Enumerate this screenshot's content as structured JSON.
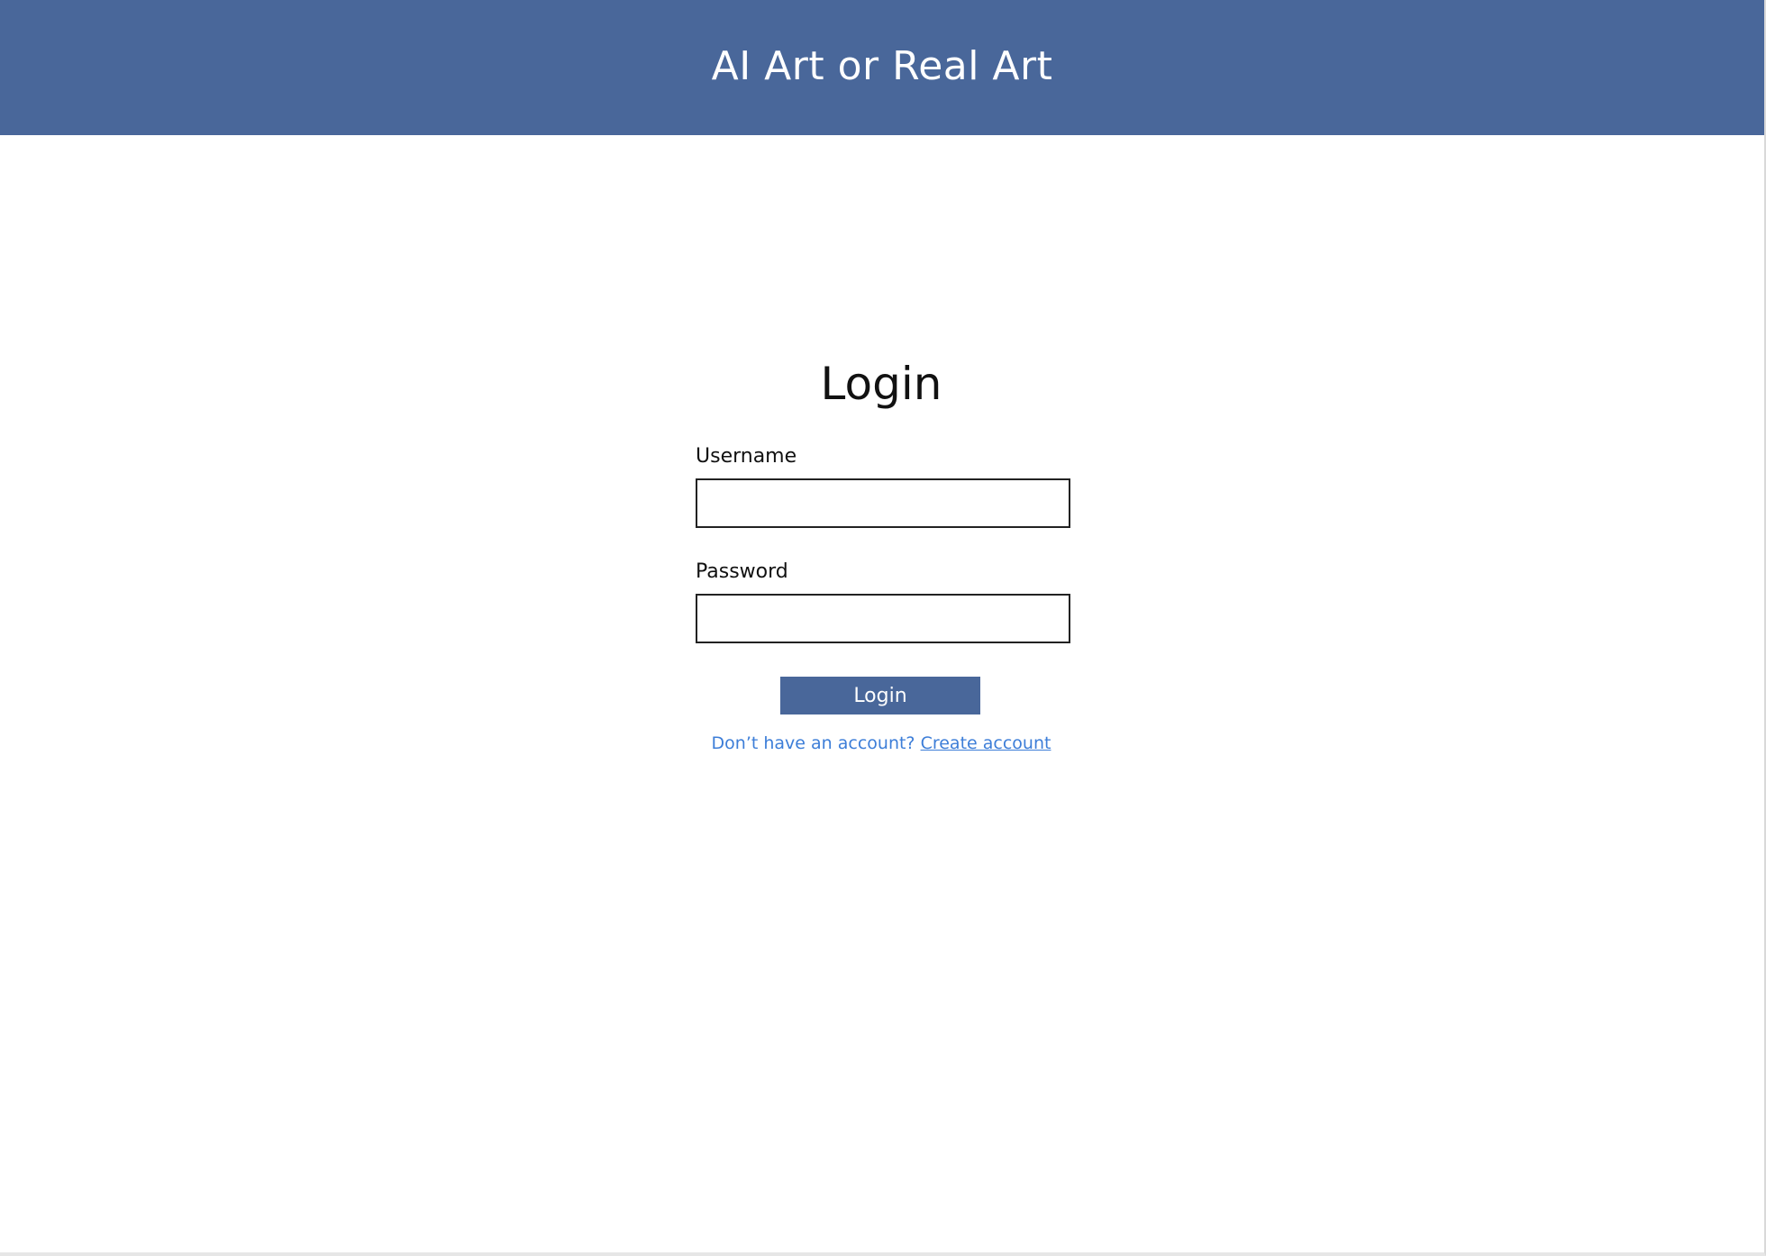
{
  "header": {
    "title": "AI Art or Real Art"
  },
  "login_form": {
    "title": "Login",
    "username_label": "Username",
    "username_value": "",
    "password_label": "Password",
    "password_value": "",
    "submit_label": "Login",
    "signup_prompt": "Don’t have an account?",
    "signup_link": "Create account"
  },
  "colors": {
    "brand": "#49679a",
    "link": "#3d7ed8",
    "input_border": "#222222",
    "background": "#ffffff"
  }
}
